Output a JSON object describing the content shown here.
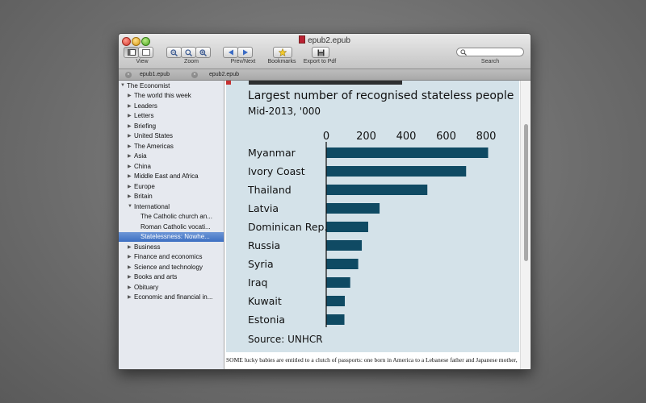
{
  "window": {
    "title": "epub2.epub"
  },
  "toolbar": {
    "view_label": "View",
    "zoom_label": "Zoom",
    "prevnext_label": "Prev/Next",
    "bookmarks_label": "Bookmarks",
    "export_label": "Export to Pdf",
    "search_label": "Search",
    "search_placeholder": ""
  },
  "tabs": [
    {
      "label": "epub1.epub"
    },
    {
      "label": "epub2.epub"
    }
  ],
  "sidebar": {
    "root": "The Economist",
    "items": [
      {
        "label": "The world this week"
      },
      {
        "label": "Leaders"
      },
      {
        "label": "Letters"
      },
      {
        "label": "Briefing"
      },
      {
        "label": "United States"
      },
      {
        "label": "The Americas"
      },
      {
        "label": "Asia"
      },
      {
        "label": "China"
      },
      {
        "label": "Middle East and Africa"
      },
      {
        "label": "Europe"
      },
      {
        "label": "Britain"
      },
      {
        "label": "International"
      },
      {
        "label": "The Catholic church an..."
      },
      {
        "label": "Roman Catholic vocati..."
      },
      {
        "label": "Statelessness: Nowhe..."
      },
      {
        "label": "Business"
      },
      {
        "label": "Finance and economics"
      },
      {
        "label": "Science and technology"
      },
      {
        "label": "Books and arts"
      },
      {
        "label": "Obituary"
      },
      {
        "label": "Economic and financial in..."
      }
    ]
  },
  "chart_data": {
    "type": "bar",
    "orientation": "horizontal",
    "title": "Largest number of recognised stateless people",
    "subtitle": "Mid-2013, '000",
    "source": "Source: UNHCR",
    "categories": [
      "Myanmar",
      "Ivory Coast",
      "Thailand",
      "Latvia",
      "Dominican Rep.",
      "Russia",
      "Syria",
      "Iraq",
      "Kuwait",
      "Estonia"
    ],
    "values": [
      810,
      700,
      506,
      267,
      210,
      178,
      160,
      120,
      93,
      91
    ],
    "xticks": [
      0,
      200,
      400,
      600,
      800
    ],
    "xlim": [
      0,
      820
    ],
    "bar_color": "#0f4a63",
    "background_color": "#d4e2e9"
  },
  "content": {
    "body_text": "SOME lucky babies are entitled to a clutch of passports: one born in America to a Lebanese father and Japanese mother,"
  }
}
